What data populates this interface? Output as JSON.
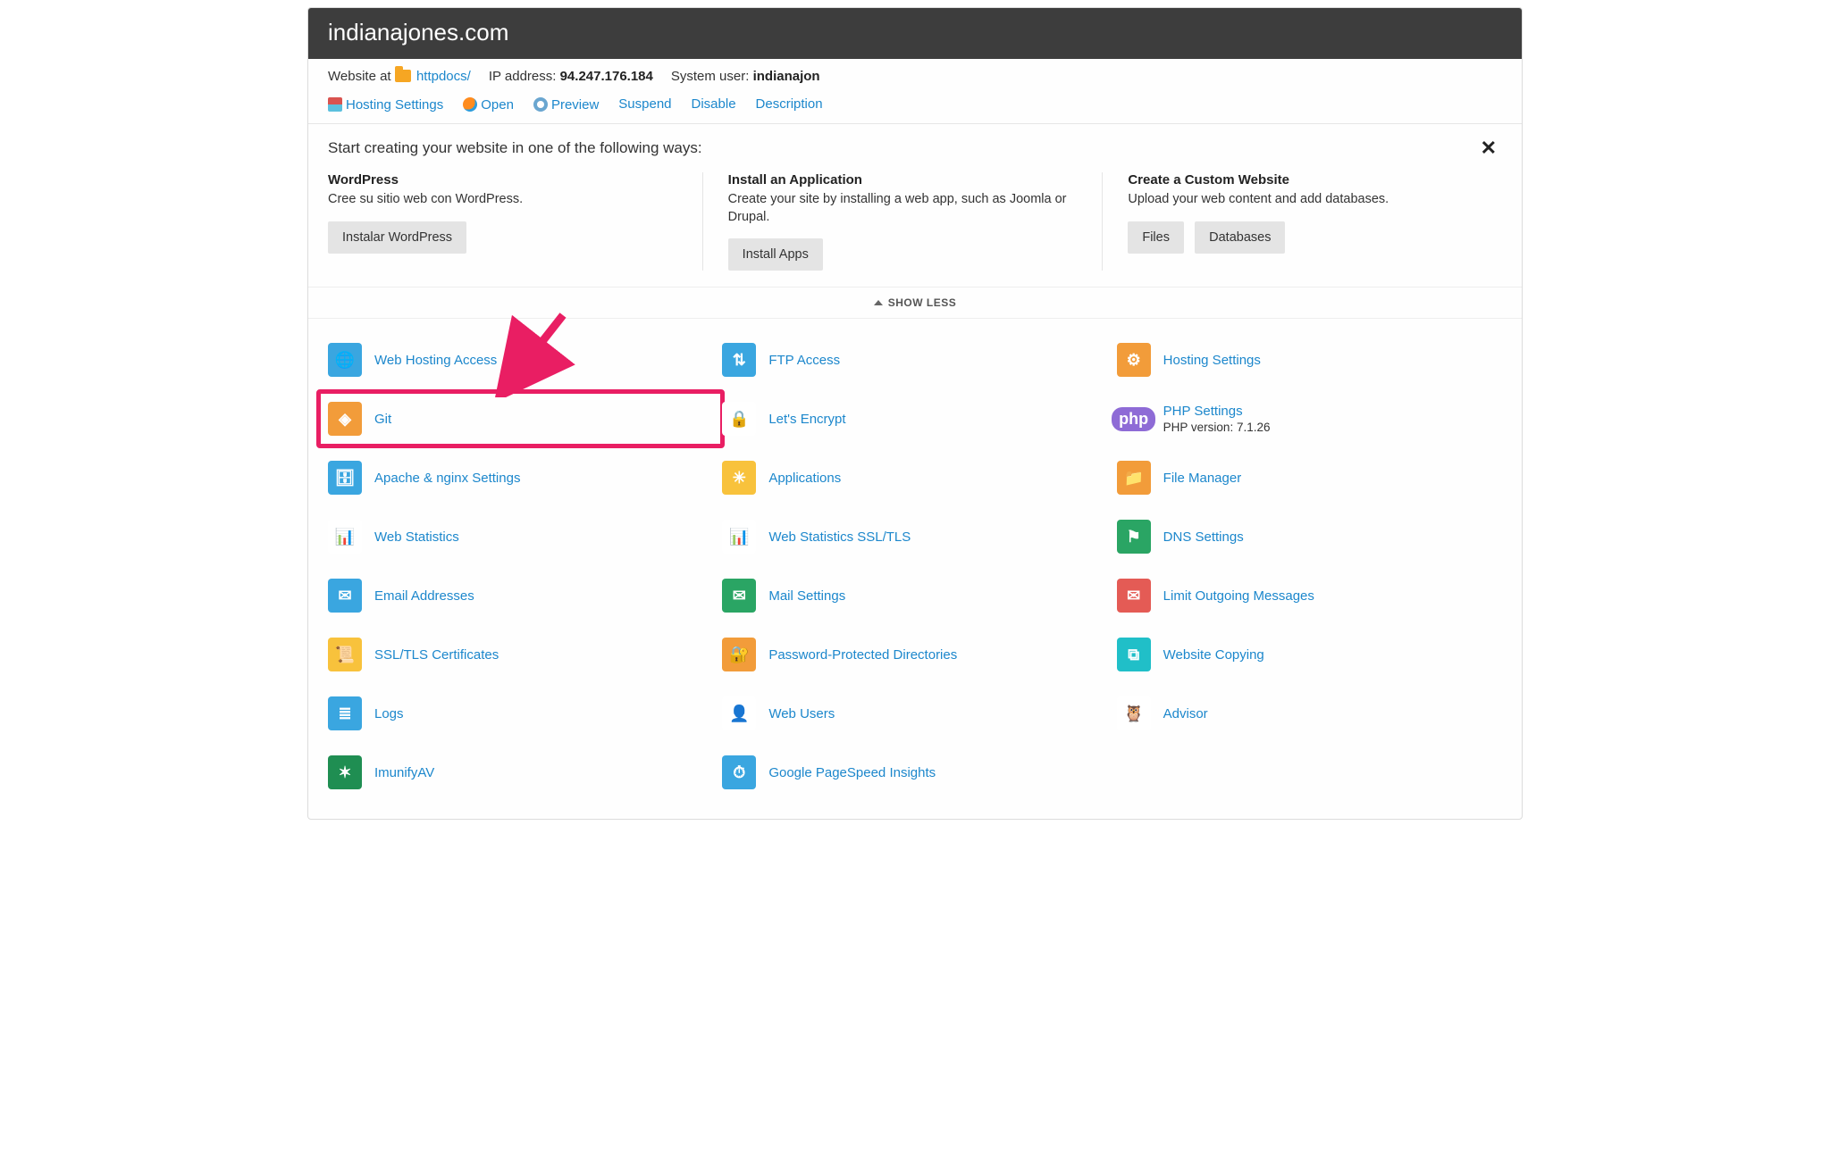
{
  "header": {
    "domain": "indianajones.com"
  },
  "subheader": {
    "website_at_label": "Website at",
    "docroot": "httpdocs/",
    "ip_label": "IP address:",
    "ip": "94.247.176.184",
    "sysuser_label": "System user:",
    "sysuser": "indianajon"
  },
  "toolbar": {
    "hosting_settings": "Hosting Settings",
    "open": "Open",
    "preview": "Preview",
    "suspend": "Suspend",
    "disable": "Disable",
    "description": "Description"
  },
  "intro": {
    "heading": "Start creating your website in one of the following ways:"
  },
  "create": {
    "wordpress": {
      "title": "WordPress",
      "desc": "Cree su sitio web con WordPress.",
      "button": "Instalar WordPress"
    },
    "install_app": {
      "title": "Install an Application",
      "desc": "Create your site by installing a web app, such as Joomla or Drupal.",
      "button": "Install Apps"
    },
    "custom": {
      "title": "Create a Custom Website",
      "desc": "Upload your web content and add databases.",
      "button_files": "Files",
      "button_db": "Databases"
    }
  },
  "show_less": "SHOW LESS",
  "tools": [
    {
      "label": "Web Hosting Access"
    },
    {
      "label": "FTP Access"
    },
    {
      "label": "Hosting Settings"
    },
    {
      "label": "Git"
    },
    {
      "label": "Let's Encrypt"
    },
    {
      "label": "PHP Settings",
      "sub": "PHP version: 7.1.26"
    },
    {
      "label": "Apache & nginx Settings"
    },
    {
      "label": "Applications"
    },
    {
      "label": "File Manager"
    },
    {
      "label": "Web Statistics"
    },
    {
      "label": "Web Statistics SSL/TLS"
    },
    {
      "label": "DNS Settings"
    },
    {
      "label": "Email Addresses"
    },
    {
      "label": "Mail Settings"
    },
    {
      "label": "Limit Outgoing Messages"
    },
    {
      "label": "SSL/TLS Certificates"
    },
    {
      "label": "Password-Protected Directories"
    },
    {
      "label": "Website Copying"
    },
    {
      "label": "Logs"
    },
    {
      "label": "Web Users"
    },
    {
      "label": "Advisor"
    },
    {
      "label": "ImunifyAV"
    },
    {
      "label": "Google PageSpeed Insights"
    }
  ]
}
